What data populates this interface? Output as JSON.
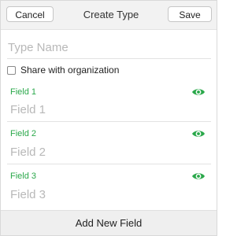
{
  "toolbar": {
    "cancel_label": "Cancel",
    "title": "Create Type",
    "save_label": "Save"
  },
  "form": {
    "type_name_placeholder": "Type Name",
    "type_name_value": "",
    "share_label": "Share with organization",
    "share_checked": false
  },
  "fields": [
    {
      "label": "Field 1",
      "placeholder": "Field 1",
      "value": "",
      "visibility_icon": "eye-icon"
    },
    {
      "label": "Field 2",
      "placeholder": "Field 2",
      "value": "",
      "visibility_icon": "eye-icon"
    },
    {
      "label": "Field 3",
      "placeholder": "Field 3",
      "value": "",
      "visibility_icon": "eye-icon"
    }
  ],
  "footer": {
    "add_field_label": "Add New Field"
  },
  "colors": {
    "accent_green": "#2aa84a",
    "toolbar_bg": "#f2f2f2",
    "footer_bg": "#efefef",
    "placeholder": "#b8b8b8"
  }
}
